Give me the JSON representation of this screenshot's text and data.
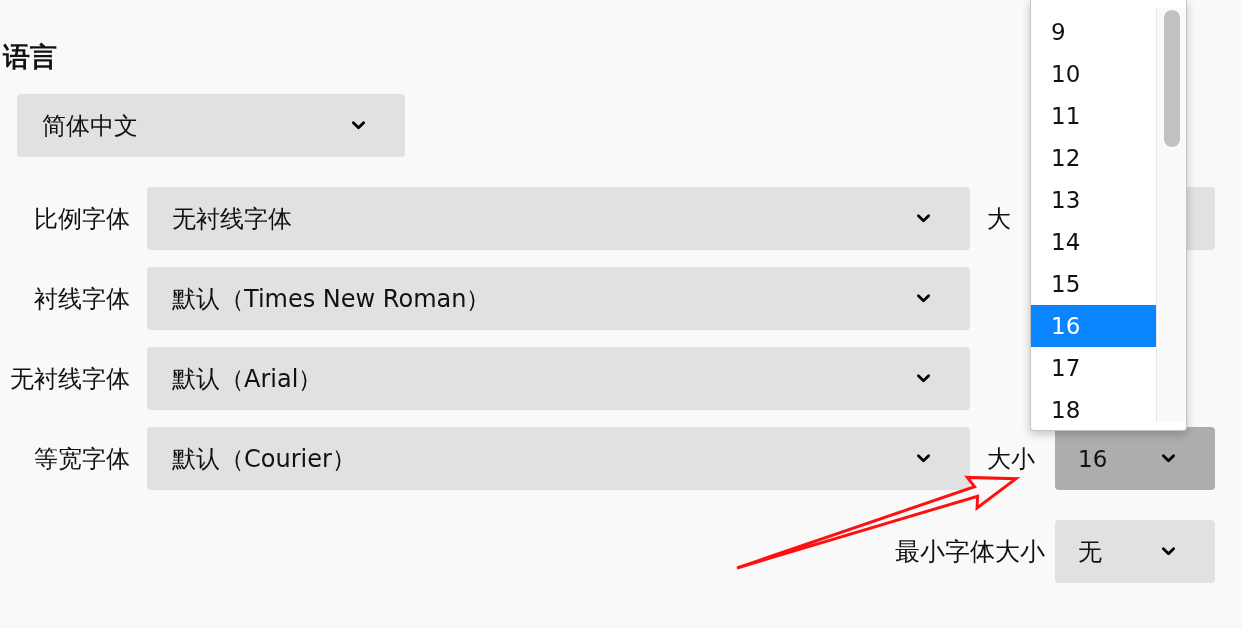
{
  "language": {
    "heading": "语言",
    "value": "简体中文"
  },
  "fonts": [
    {
      "label": "比例字体",
      "value": "无衬线字体",
      "size": {
        "label": "大",
        "open": false
      }
    },
    {
      "label": "衬线字体",
      "value": "默认（Times New Roman）"
    },
    {
      "label": "无衬线字体",
      "value": "默认（Arial）"
    },
    {
      "label": "等宽字体",
      "value": "默认（Courier）",
      "size": {
        "label": "大小",
        "value": "16",
        "open": true,
        "options": [
          {
            "label": "9",
            "selected": false
          },
          {
            "label": "10",
            "selected": false
          },
          {
            "label": "11",
            "selected": false
          },
          {
            "label": "12",
            "selected": false
          },
          {
            "label": "13",
            "selected": false
          },
          {
            "label": "14",
            "selected": false
          },
          {
            "label": "15",
            "selected": false
          },
          {
            "label": "16",
            "selected": true
          },
          {
            "label": "17",
            "selected": false
          },
          {
            "label": "18",
            "selected": false
          }
        ]
      }
    }
  ],
  "minimum_size": {
    "label": "最小字体大小",
    "value": "无"
  }
}
